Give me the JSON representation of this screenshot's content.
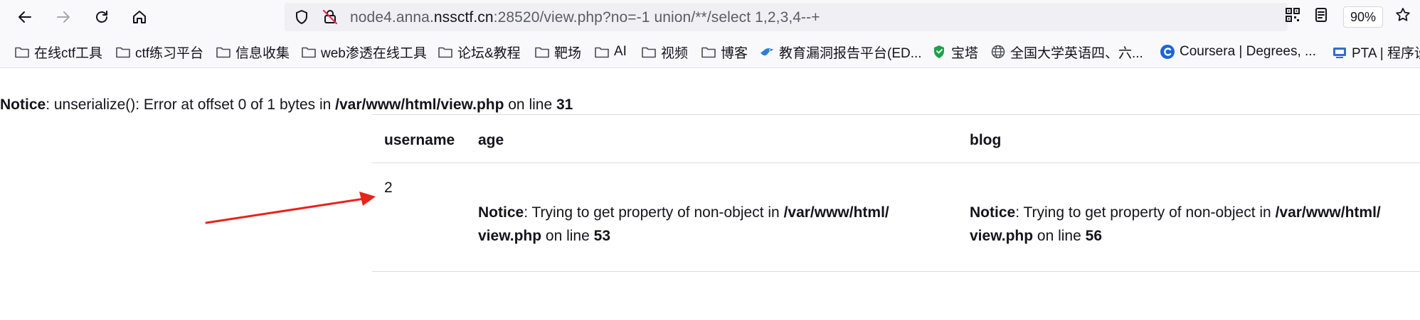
{
  "browser": {
    "url": {
      "prefix": "node4.anna.",
      "domain": "nssctf.cn",
      "suffix": ":28520/view.php?no=-1 union/**/select 1,2,3,4--+"
    },
    "zoom": "90%",
    "icons": {
      "back": "back-arrow-icon",
      "forward": "forward-arrow-icon",
      "reload": "reload-icon",
      "home": "home-icon",
      "shield": "tracking-protection-shield-icon",
      "insecure": "insecure-lock-icon",
      "qr": "qr-code-icon",
      "reader": "reader-view-icon",
      "bookmark_star": "bookmark-star-icon"
    }
  },
  "bookmarks": [
    {
      "label": "在线ctf工具",
      "icon": "folder-icon"
    },
    {
      "label": "ctf练习平台",
      "icon": "folder-icon"
    },
    {
      "label": "信息收集",
      "icon": "folder-icon"
    },
    {
      "label": "web渗透在线工具",
      "icon": "folder-icon"
    },
    {
      "label": "论坛&教程",
      "icon": "folder-icon"
    },
    {
      "label": "靶场",
      "icon": "folder-icon"
    },
    {
      "label": "AI",
      "icon": "folder-icon"
    },
    {
      "label": "视频",
      "icon": "folder-icon"
    },
    {
      "label": "博客",
      "icon": "folder-icon"
    },
    {
      "label": "教育漏洞报告平台(ED...",
      "icon": "bird-logo-icon"
    },
    {
      "label": "宝塔",
      "icon": "shield-logo-icon"
    },
    {
      "label": "全国大学英语四、六...",
      "icon": "globe-icon"
    },
    {
      "label": "Coursera | Degrees, ...",
      "icon": "coursera-logo-icon"
    },
    {
      "label": "PTA | 程序设",
      "icon": "pta-logo-icon"
    }
  ],
  "page": {
    "notice_top": {
      "label": "Notice",
      "msg": ": unserialize(): Error at offset 0 of 1 bytes in ",
      "path": "/var/www/html/view.php",
      "on_line": " on line ",
      "line": "31"
    },
    "table": {
      "headers": [
        "username",
        "age",
        "blog"
      ],
      "row": {
        "username": "2",
        "age_notice": {
          "label": "Notice",
          "msg": ": Trying to get property of non-object in ",
          "path1": "/var/www/html/",
          "path2": "view.php",
          "on_line": " on line ",
          "line": "53"
        },
        "blog_notice": {
          "label": "Notice",
          "msg": ": Trying to get property of non-object in ",
          "path1": "/var/www/html/",
          "path2": "view.php",
          "on_line": " on line ",
          "line": "56"
        }
      }
    }
  },
  "colors": {
    "toolbar_bg": "#f9f9fb",
    "urlbar_bg": "#f0f0f4",
    "annotation_arrow": "#e8231a",
    "folder_stroke": "#4a4a55"
  }
}
